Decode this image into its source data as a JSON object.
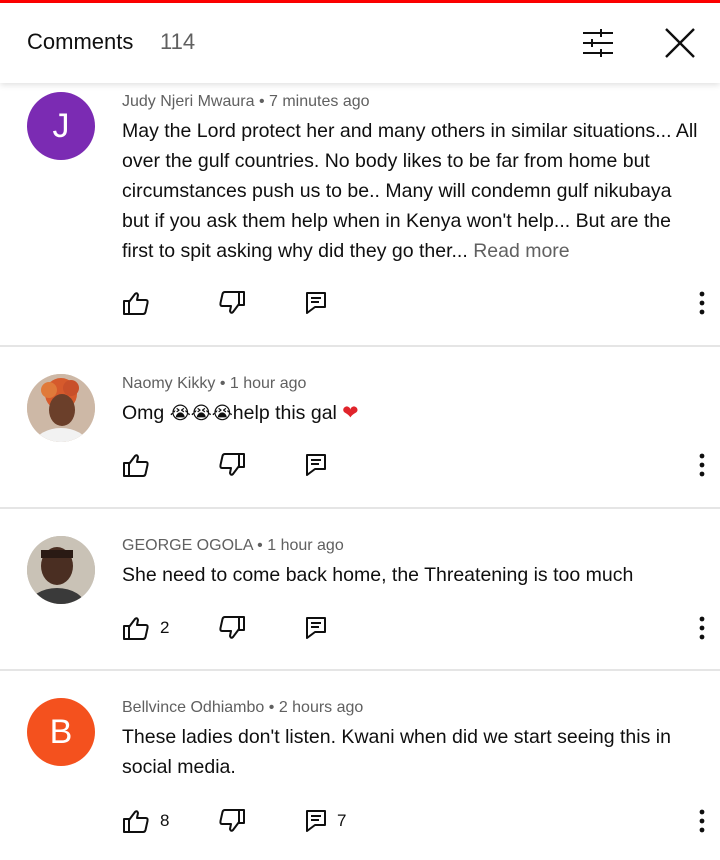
{
  "header": {
    "title": "Comments",
    "count": "114"
  },
  "colors": {
    "accent_red": "#ff0000",
    "heart": "#e0242b"
  },
  "comments": [
    {
      "author": "Judy Njeri Mwaura",
      "time": "7 minutes ago",
      "avatar_letter": "J",
      "avatar_color": "#7b2bb3",
      "text": "May the Lord protect her and many others in similar situations... All over the gulf countries. No body likes to be far from home but circumstances push us to be.. Many will condemn gulf nikubaya but if you ask them help when in Kenya won't help... But are the first to spit asking why did they go ther...",
      "read_more": "Read more",
      "likes": "",
      "replies": ""
    },
    {
      "author": "Naomy Kikky",
      "time": "1 hour ago",
      "avatar_icon": "profile-photo",
      "text_before": "Omg ",
      "emojis": "😭😭😭",
      "text_after": "help this gal ",
      "heart": "❤",
      "likes": "",
      "replies": ""
    },
    {
      "author": "GEORGE OGOLA",
      "time": "1 hour ago",
      "avatar_icon": "profile-photo",
      "text": "She need to come back home, the Threatening is too much",
      "likes": "2",
      "replies": ""
    },
    {
      "author": "Bellvince Odhiambo",
      "time": "2 hours ago",
      "avatar_letter": "B",
      "avatar_color": "#f4511e",
      "text": "These ladies don't listen. Kwani when did we start seeing this in social media.",
      "likes": "8",
      "replies": "7"
    }
  ],
  "separator": "•"
}
